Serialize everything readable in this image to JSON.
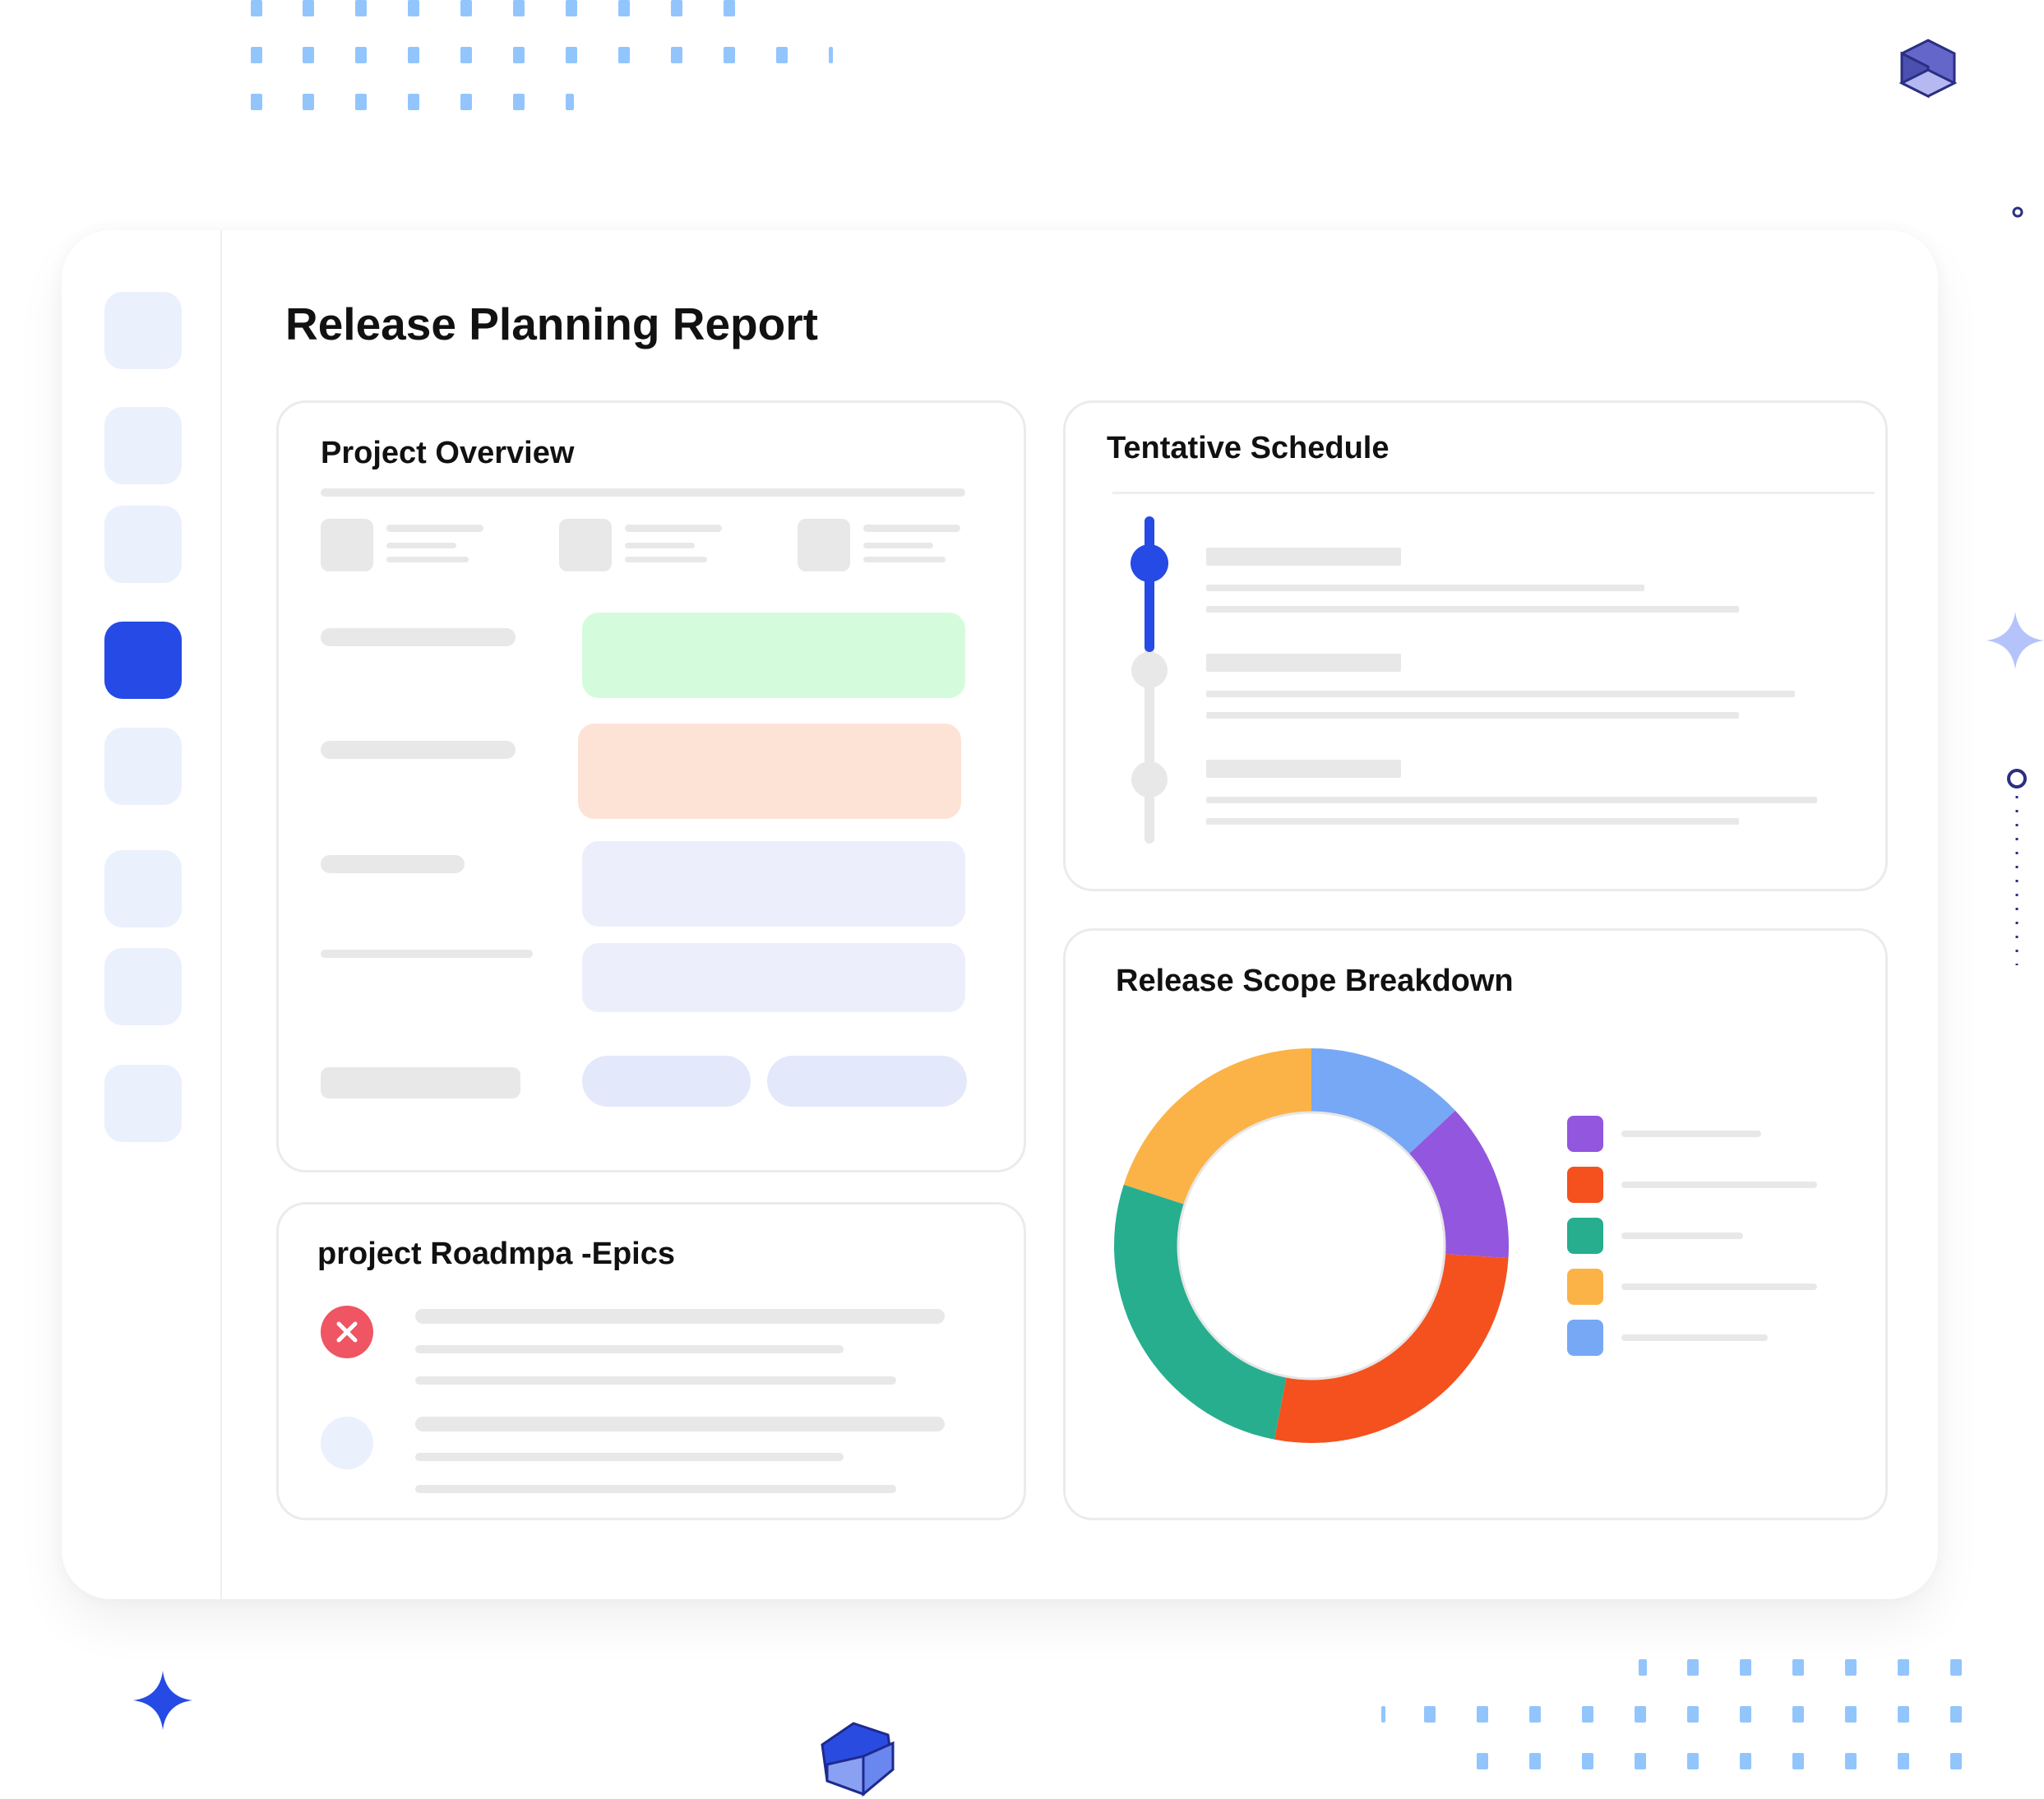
{
  "report": {
    "title": "Release Planning Report"
  },
  "sidebar": {
    "items": [
      {
        "id": "nav-1",
        "active": false
      },
      {
        "id": "nav-2",
        "active": false
      },
      {
        "id": "nav-3",
        "active": false
      },
      {
        "id": "nav-4",
        "active": true
      },
      {
        "id": "nav-5",
        "active": false
      },
      {
        "id": "nav-6",
        "active": false
      },
      {
        "id": "nav-7",
        "active": false
      },
      {
        "id": "nav-8",
        "active": false
      }
    ]
  },
  "cards": {
    "overview": {
      "title": "Project Overview"
    },
    "schedule": {
      "title": "Tentative Schedule"
    },
    "roadmap": {
      "title": "project Roadmpa -Epics",
      "status_icons": [
        "close-icon",
        "empty-status-icon"
      ]
    },
    "scope": {
      "title": "Release Scope Breakdown"
    }
  },
  "colors": {
    "accent": "#264ae5",
    "green_field": "#d4fcdc",
    "orange_field": "#fde3d6",
    "neutral_field": "#eceffb",
    "error": "#ef5562"
  },
  "chart_data": {
    "type": "pie",
    "donut": true,
    "slices": [
      {
        "color": "#fbb347",
        "value": 20
      },
      {
        "color": "#77a8f5",
        "value": 13
      },
      {
        "color": "#9356de",
        "value": 13
      },
      {
        "color": "#f4511e",
        "value": 27
      },
      {
        "color": "#26ae8f",
        "value": 27
      }
    ],
    "legend_colors": [
      "#9356de",
      "#f4511e",
      "#26ae8f",
      "#fbb347",
      "#77a8f5"
    ]
  }
}
